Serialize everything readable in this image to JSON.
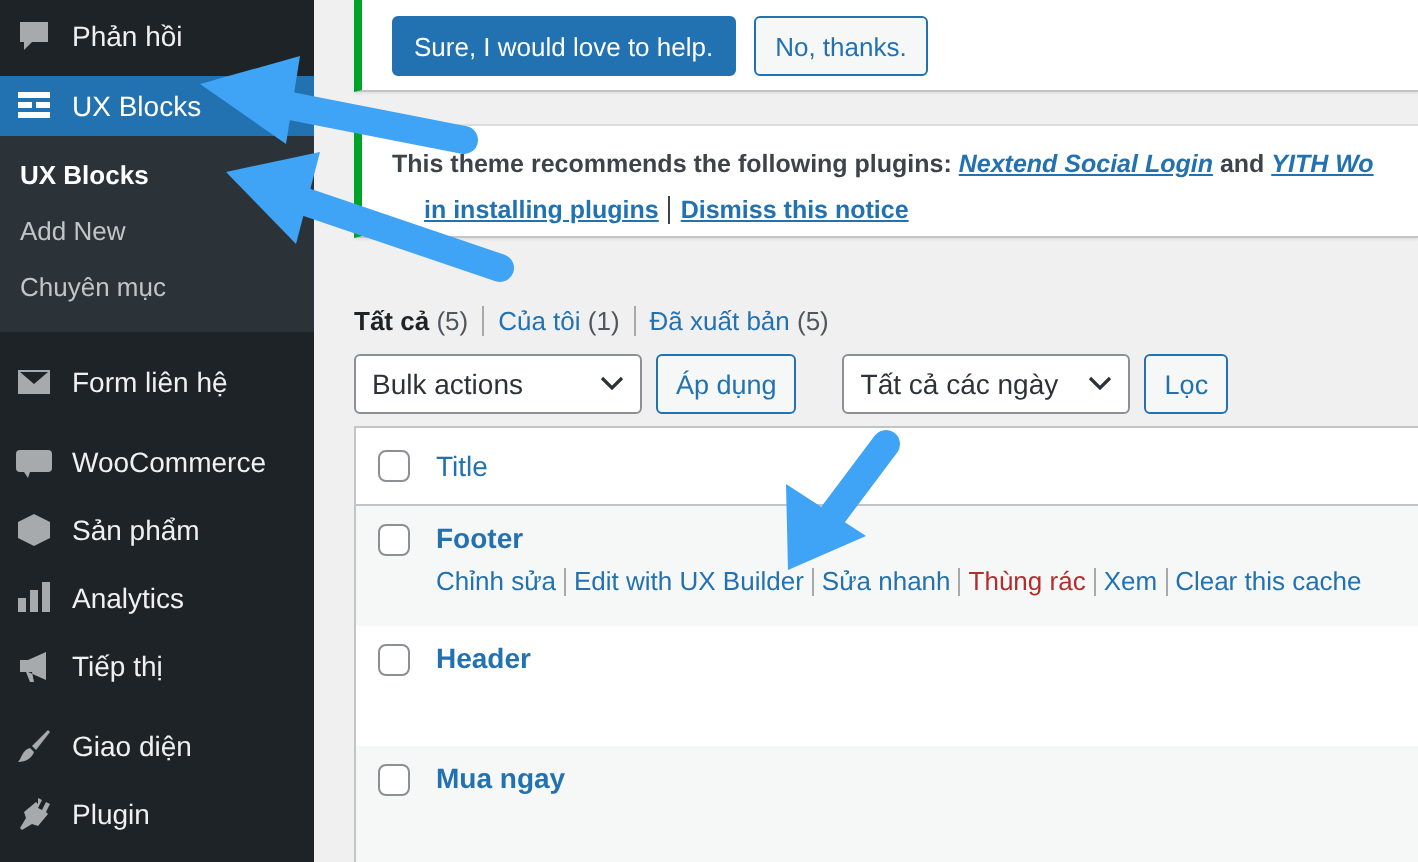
{
  "sidebar": {
    "items": [
      {
        "label": "Phản hồi",
        "kind": "comment",
        "selected": false
      },
      {
        "label": "UX Blocks",
        "kind": "blocks",
        "selected": true,
        "children": [
          {
            "label": "UX Blocks",
            "selected": true
          },
          {
            "label": "Add New",
            "selected": false
          },
          {
            "label": "Chuyên mục",
            "selected": false
          }
        ]
      },
      {
        "kind": "separator"
      },
      {
        "label": "Form liên hệ",
        "kind": "mail",
        "selected": false
      },
      {
        "kind": "separator"
      },
      {
        "label": "WooCommerce",
        "kind": "woo",
        "selected": false
      },
      {
        "label": "Sản phẩm",
        "kind": "box",
        "selected": false
      },
      {
        "label": "Analytics",
        "kind": "bars",
        "selected": false
      },
      {
        "label": "Tiếp thị",
        "kind": "megaphone",
        "selected": false
      },
      {
        "kind": "separator"
      },
      {
        "label": "Giao diện",
        "kind": "brush",
        "selected": false
      },
      {
        "label": "Plugin",
        "kind": "plug",
        "selected": false
      }
    ]
  },
  "notices": [
    {
      "kind": "buttons",
      "buttons": [
        {
          "label": "Sure, I would love to help.",
          "primary": true
        },
        {
          "label": "No, thanks.",
          "primary": false
        }
      ]
    },
    {
      "kind": "message",
      "text": [
        {
          "kind": "text",
          "text": "This theme recommends the following plugins: "
        },
        {
          "kind": "link",
          "text": "Nextend Social Login"
        },
        {
          "kind": "text",
          "text": " and "
        },
        {
          "kind": "link",
          "text": "YITH Wo"
        }
      ],
      "links": [
        "in installing plugins",
        "Dismiss this notice"
      ]
    }
  ],
  "views": [
    {
      "label": "Tất cả",
      "count": "(5)",
      "selected": true
    },
    {
      "label": "Của tôi",
      "count": "(1)",
      "selected": false
    },
    {
      "label": "Đã xuất bản",
      "count": "(5)",
      "selected": false
    }
  ],
  "toolbar": {
    "bulk_select": "Bulk actions",
    "apply_button": "Áp dụng",
    "date_select": "Tất cả các ngày",
    "filter_button": "Lọc"
  },
  "table": {
    "select_all_checked": false,
    "columns": [
      "Title"
    ],
    "rows": [
      {
        "title": "Footer",
        "checked": false,
        "actions": [
          {
            "label": "Chỉnh sửa",
            "kind": "link"
          },
          {
            "label": "Edit with UX Builder",
            "kind": "link"
          },
          {
            "label": "Sửa nhanh",
            "kind": "link"
          },
          {
            "label": "Thùng rác",
            "kind": "trash"
          },
          {
            "label": "Xem",
            "kind": "link"
          },
          {
            "label": "Clear this cache",
            "kind": "link"
          }
        ]
      },
      {
        "title": "Header",
        "checked": false
      },
      {
        "title": "Mua ngay",
        "checked": false
      }
    ]
  }
}
